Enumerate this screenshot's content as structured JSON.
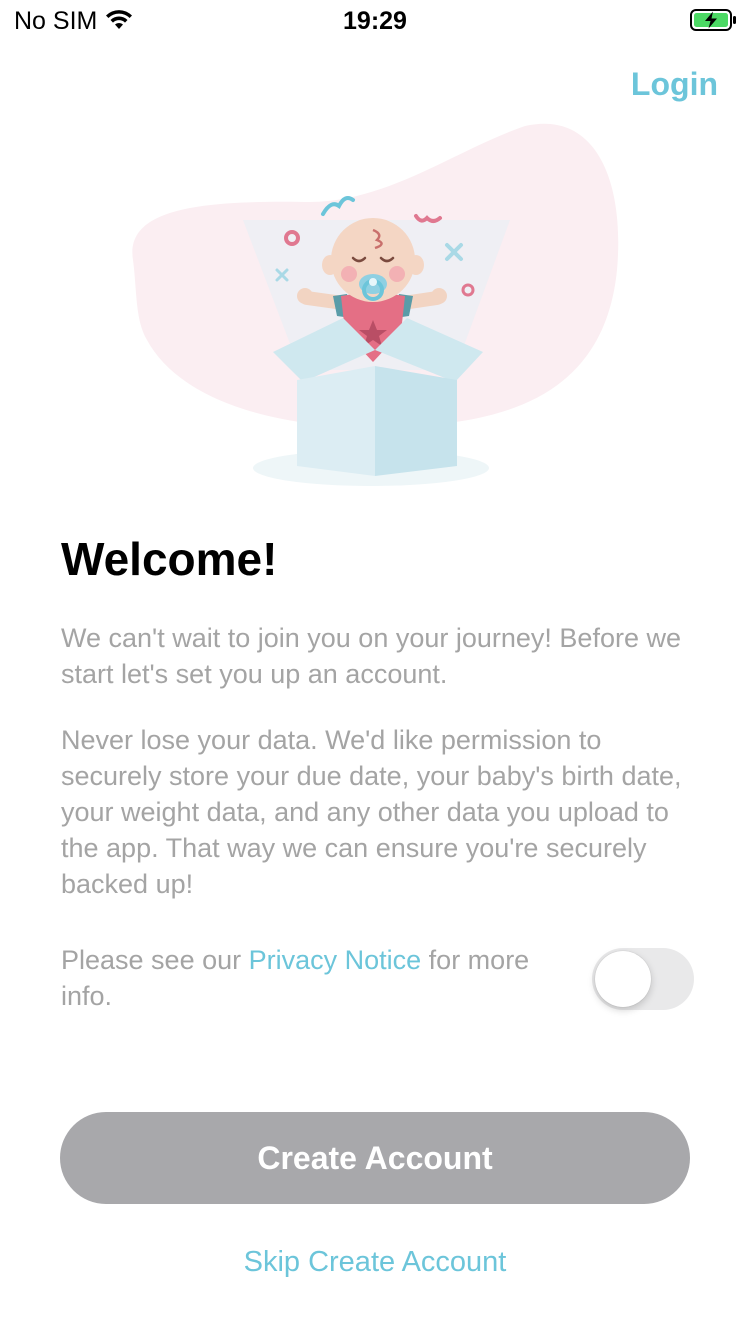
{
  "status_bar": {
    "carrier": "No SIM",
    "time": "19:29",
    "wifi_icon": "wifi-icon",
    "battery_icon": "battery-charging-icon",
    "battery_color": "#4cd964"
  },
  "header": {
    "login_label": "Login"
  },
  "illustration": {
    "icon": "baby-in-gift-box-illustration"
  },
  "welcome": {
    "title": "Welcome!",
    "intro": "We can't wait to join you on your journey! Before we start let's set you up an account.",
    "permission": "Never lose your data. We'd like permission to securely store your due date, your baby's birth date, your weight data, and any other data you upload to the app. That way we can ensure you're securely backed up!"
  },
  "privacy": {
    "prefix": "Please see our ",
    "link_label": "Privacy Notice",
    "suffix": " for more info.",
    "toggle_on": false
  },
  "actions": {
    "create_label": "Create Account",
    "skip_label": "Skip Create Account"
  },
  "colors": {
    "accent": "#6cc5da",
    "muted_text": "#a4a4a4",
    "disabled_button": "#a8a8ab",
    "blob_pink": "#fbeef2"
  }
}
